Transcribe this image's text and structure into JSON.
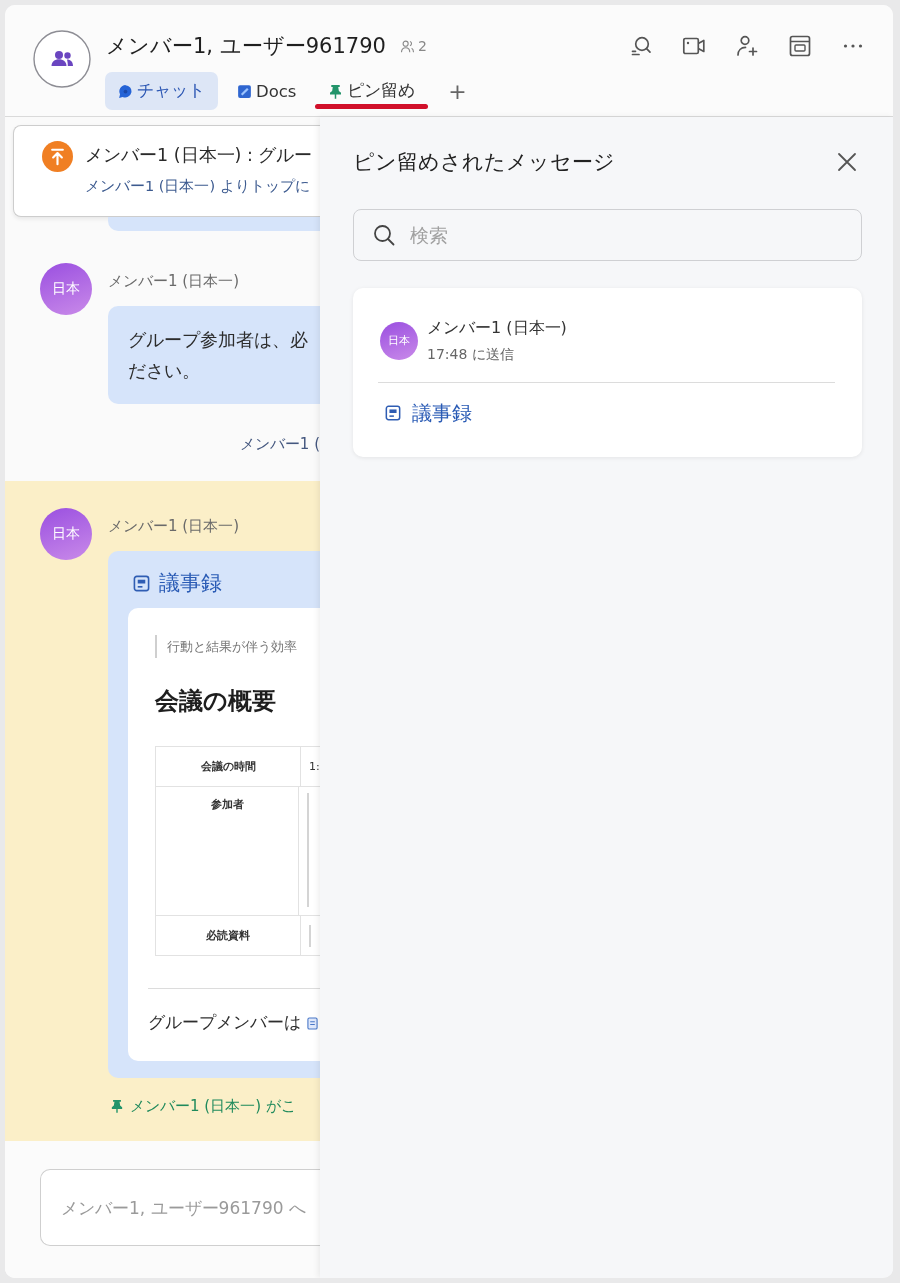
{
  "header": {
    "title": "メンバー1, ユーザー961790",
    "member_count": "2",
    "tabs": [
      {
        "label": "チャット",
        "kind": "chat",
        "selected": true,
        "highlighted": false
      },
      {
        "label": "Docs",
        "kind": "docs",
        "selected": false,
        "highlighted": false
      },
      {
        "label": "ピン留め",
        "kind": "pin",
        "selected": false,
        "highlighted": true
      }
    ],
    "add_tab": "+"
  },
  "pinned_banner": {
    "title": "メンバー1 (日本一) : グルー",
    "subtitle": "メンバー1 (日本一) よりトップに"
  },
  "messages": [
    {
      "kind": "partial"
    },
    {
      "kind": "text",
      "highlighted": false,
      "avatar": "日本",
      "sender": "メンバー1 (日本一)",
      "lines": [
        "グループ参加者は、必",
        "ださい。"
      ]
    },
    {
      "kind": "system",
      "text": "メンバー1 ("
    },
    {
      "kind": "doc",
      "highlighted": true,
      "avatar": "日本",
      "sender": "メンバー1 (日本一)",
      "doc": {
        "title": "議事録",
        "quote": "行動と結果が伴う効率",
        "heading": "会議の概要",
        "rows": [
          {
            "label": "会議の時間",
            "value": "1:"
          },
          {
            "label": "参加者"
          },
          {
            "label": "必読資料"
          }
        ],
        "footer": "グループメンバーは"
      },
      "pin_notice": "メンバー1 (日本一) がこ"
    }
  ],
  "composer": {
    "placeholder": "メンバー1, ユーザー961790 へ"
  },
  "pinned_panel": {
    "title": "ピン留めされたメッセージ",
    "search_placeholder": "検索",
    "items": [
      {
        "avatar": "日本",
        "sender": "メンバー1 (日本一)",
        "time": "17:48 に送信",
        "doc_title": "議事録"
      }
    ]
  }
}
